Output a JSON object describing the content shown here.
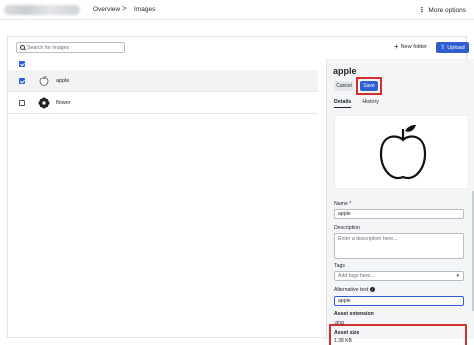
{
  "header": {
    "breadcrumb": [
      "Overview",
      "Images"
    ],
    "separator": ">",
    "more_label": "More options"
  },
  "toolbar": {
    "search_placeholder": "Search for images",
    "new_folder_label": "New folder",
    "upload_label": "Upload"
  },
  "list": {
    "items": [
      {
        "name": "apple",
        "selected": true,
        "icon": "apple-icon"
      },
      {
        "name": "flower",
        "selected": false,
        "icon": "flower-icon"
      }
    ]
  },
  "detail": {
    "title": "apple",
    "cancel_label": "Cancel",
    "save_label": "Save",
    "tabs": [
      "Details",
      "History"
    ],
    "fields": {
      "name_label": "Name *",
      "name_value": "apple",
      "description_label": "Description",
      "description_placeholder": "Enter a description here...",
      "tags_label": "Tags",
      "tags_placeholder": "Add tags here...",
      "alt_label": "Alternative text",
      "alt_value": "apple",
      "ext_label": "Asset extension",
      "ext_value": ".png",
      "size_label": "Asset size",
      "size_value": "1.38 KB"
    }
  },
  "colors": {
    "accent": "#2f5fd0",
    "highlight": "#d32f2f"
  }
}
